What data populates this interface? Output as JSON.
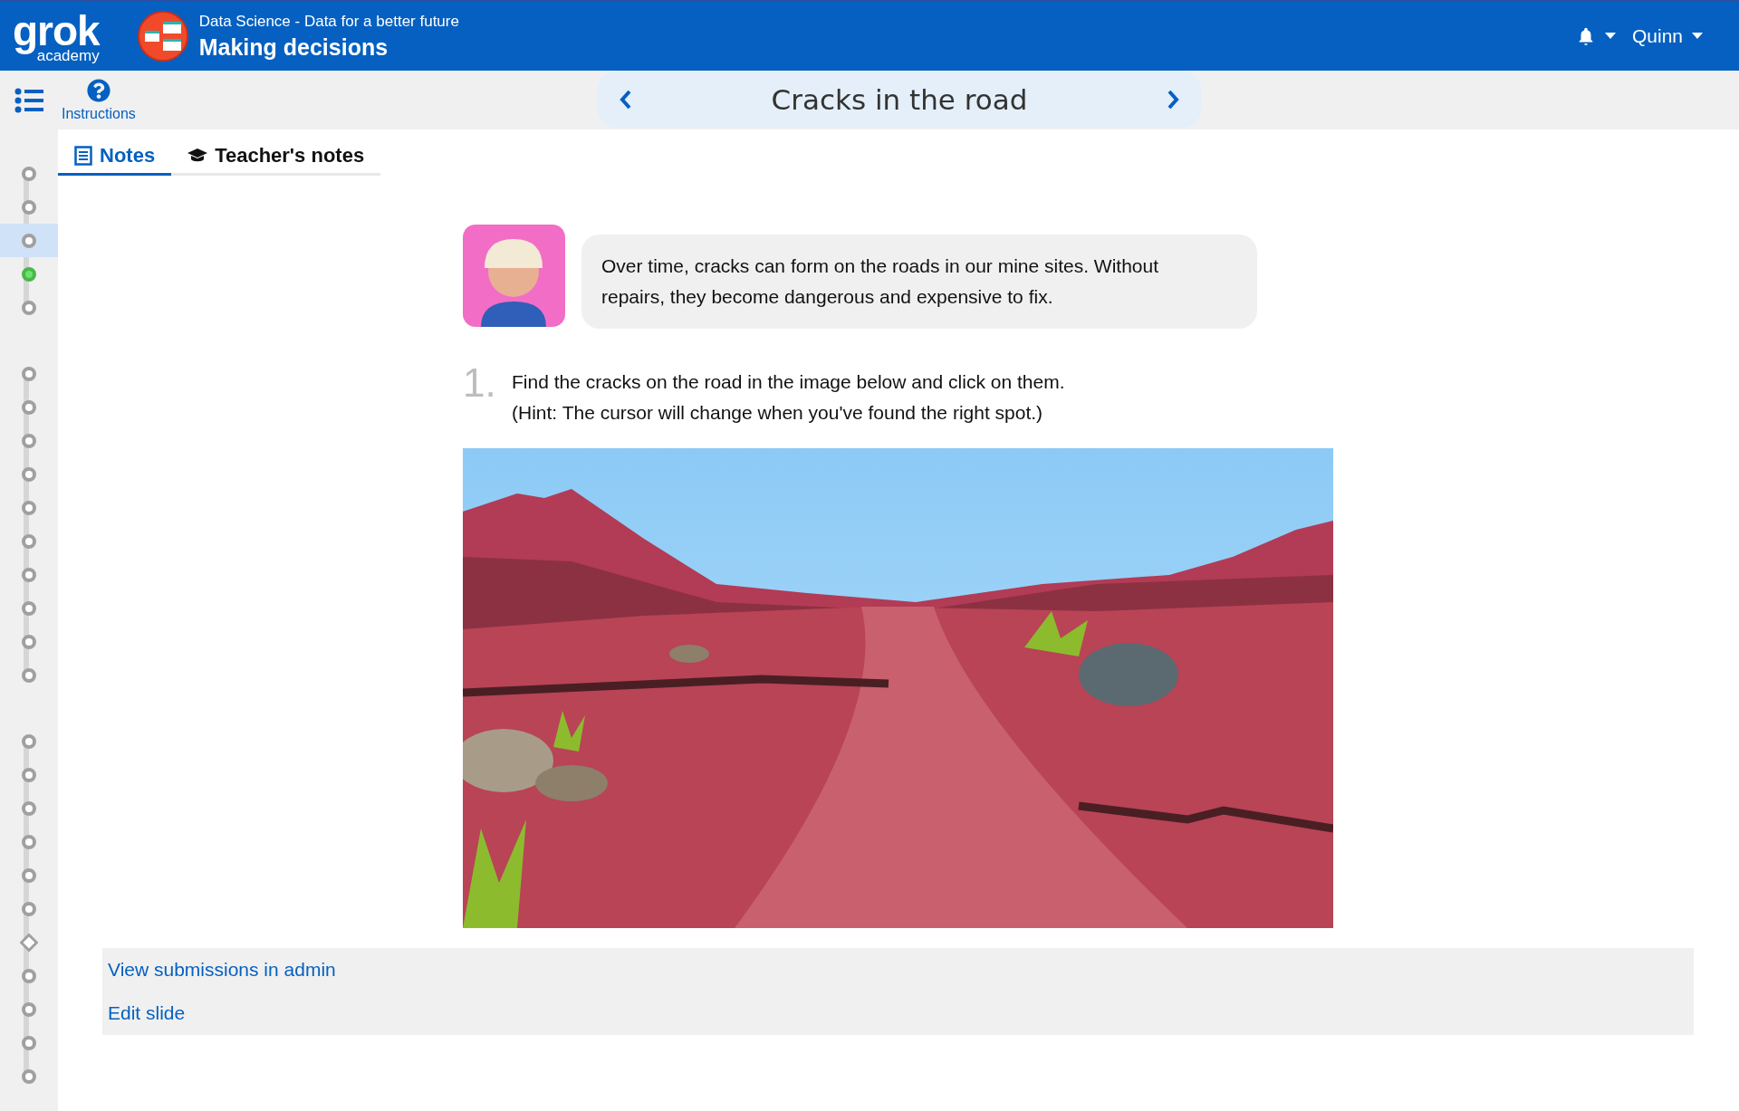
{
  "header": {
    "logo_main": "grok",
    "logo_sub": "academy",
    "course": "Data Science - Data for a better future",
    "module": "Making decisions",
    "user": "Quinn"
  },
  "toolbar": {
    "instructions": "Instructions",
    "slide_title": "Cracks in the road"
  },
  "tabs": [
    {
      "label": "Notes",
      "selected": true,
      "kind": "notes"
    },
    {
      "label": "Teacher's notes",
      "selected": false,
      "kind": "teacher"
    }
  ],
  "sidebar": {
    "groups": [
      {
        "steps": [
          {
            "kind": "circle",
            "selected": false,
            "completed": false
          },
          {
            "kind": "circle",
            "selected": false,
            "completed": false
          },
          {
            "kind": "circle",
            "selected": true,
            "completed": false
          },
          {
            "kind": "circle",
            "selected": false,
            "completed": true
          },
          {
            "kind": "circle",
            "selected": false,
            "completed": false
          }
        ]
      },
      {
        "steps": [
          {
            "kind": "circle",
            "selected": false,
            "completed": false
          },
          {
            "kind": "circle",
            "selected": false,
            "completed": false
          },
          {
            "kind": "circle",
            "selected": false,
            "completed": false
          },
          {
            "kind": "circle",
            "selected": false,
            "completed": false
          },
          {
            "kind": "circle",
            "selected": false,
            "completed": false
          },
          {
            "kind": "circle",
            "selected": false,
            "completed": false
          },
          {
            "kind": "circle",
            "selected": false,
            "completed": false
          },
          {
            "kind": "circle",
            "selected": false,
            "completed": false
          },
          {
            "kind": "circle",
            "selected": false,
            "completed": false
          },
          {
            "kind": "circle",
            "selected": false,
            "completed": false
          }
        ]
      },
      {
        "steps": [
          {
            "kind": "circle",
            "selected": false,
            "completed": false
          },
          {
            "kind": "circle",
            "selected": false,
            "completed": false
          },
          {
            "kind": "circle",
            "selected": false,
            "completed": false
          },
          {
            "kind": "circle",
            "selected": false,
            "completed": false
          },
          {
            "kind": "circle",
            "selected": false,
            "completed": false
          },
          {
            "kind": "circle",
            "selected": false,
            "completed": false
          },
          {
            "kind": "diamond",
            "selected": false,
            "completed": false
          },
          {
            "kind": "circle",
            "selected": false,
            "completed": false
          },
          {
            "kind": "circle",
            "selected": false,
            "completed": false
          },
          {
            "kind": "circle",
            "selected": false,
            "completed": false
          },
          {
            "kind": "circle",
            "selected": false,
            "completed": false
          }
        ]
      }
    ]
  },
  "content": {
    "speech": "Over time, cracks can form on the roads in our mine sites. Without repairs, they become dangerous and expensive to fix.",
    "step_number": "1.",
    "step_lines": [
      "Find the cracks on the road in the image below and click on them.",
      "(Hint: The cursor will change when you've found the right spot.)"
    ]
  },
  "admin_links": [
    "View submissions in admin",
    "Edit slide"
  ]
}
